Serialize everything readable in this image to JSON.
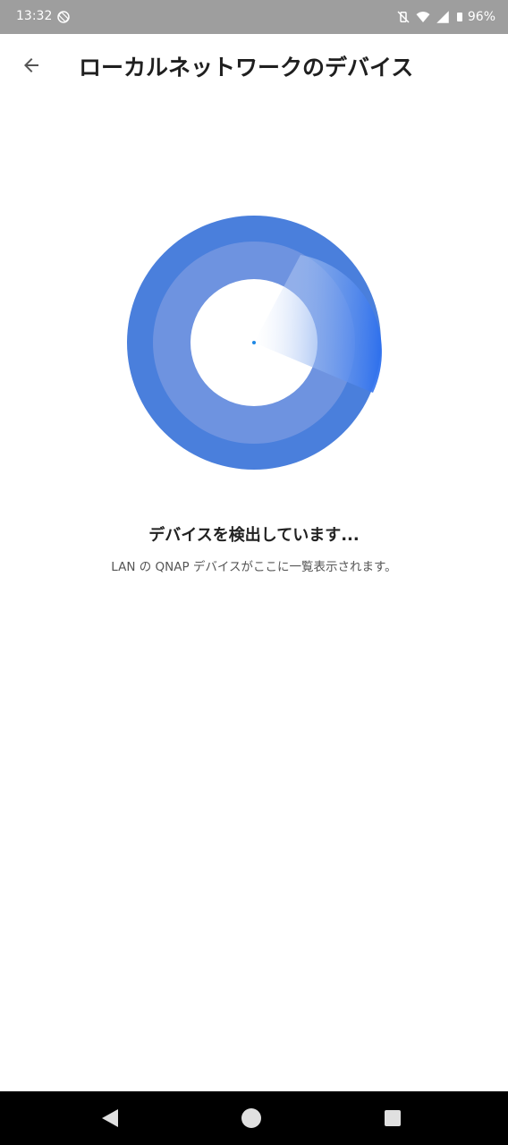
{
  "status_bar": {
    "time": "13:32",
    "battery": "96%",
    "icons": [
      "screen-rotation-icon",
      "mute-vibrate-icon",
      "wifi-icon",
      "signal-icon",
      "battery-icon"
    ]
  },
  "app_bar": {
    "title": "ローカルネットワークのデバイス",
    "back_icon": "arrow-back-icon"
  },
  "scanner": {
    "title": "デバイスを検出しています...",
    "subtitle": "LAN の QNAP デバイスがここに一覧表示されます。",
    "colors": {
      "outer_ring": "#4a7fdc",
      "inner_ring": "#6e93e0",
      "sweep": "#2f6fe8",
      "center_dot": "#1e88e5"
    }
  },
  "nav_bar": {
    "icons": [
      "nav-back-icon",
      "nav-home-icon",
      "nav-recents-icon"
    ]
  }
}
